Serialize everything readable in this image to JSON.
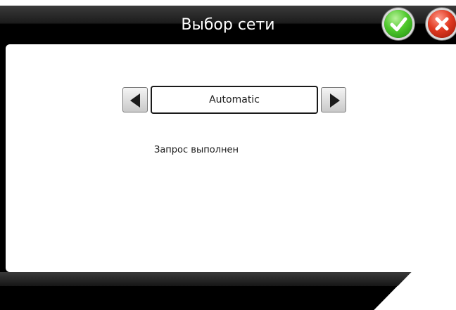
{
  "header": {
    "title": "Выбор сети",
    "confirm_icon": "checkmark-icon",
    "cancel_icon": "close-icon",
    "confirm_color": "#4fc92c",
    "cancel_color": "#e13a22"
  },
  "selector": {
    "value": "Automatic",
    "prev_icon": "triangle-left-icon",
    "next_icon": "triangle-right-icon"
  },
  "status": {
    "text": "Запрос выполнен"
  }
}
